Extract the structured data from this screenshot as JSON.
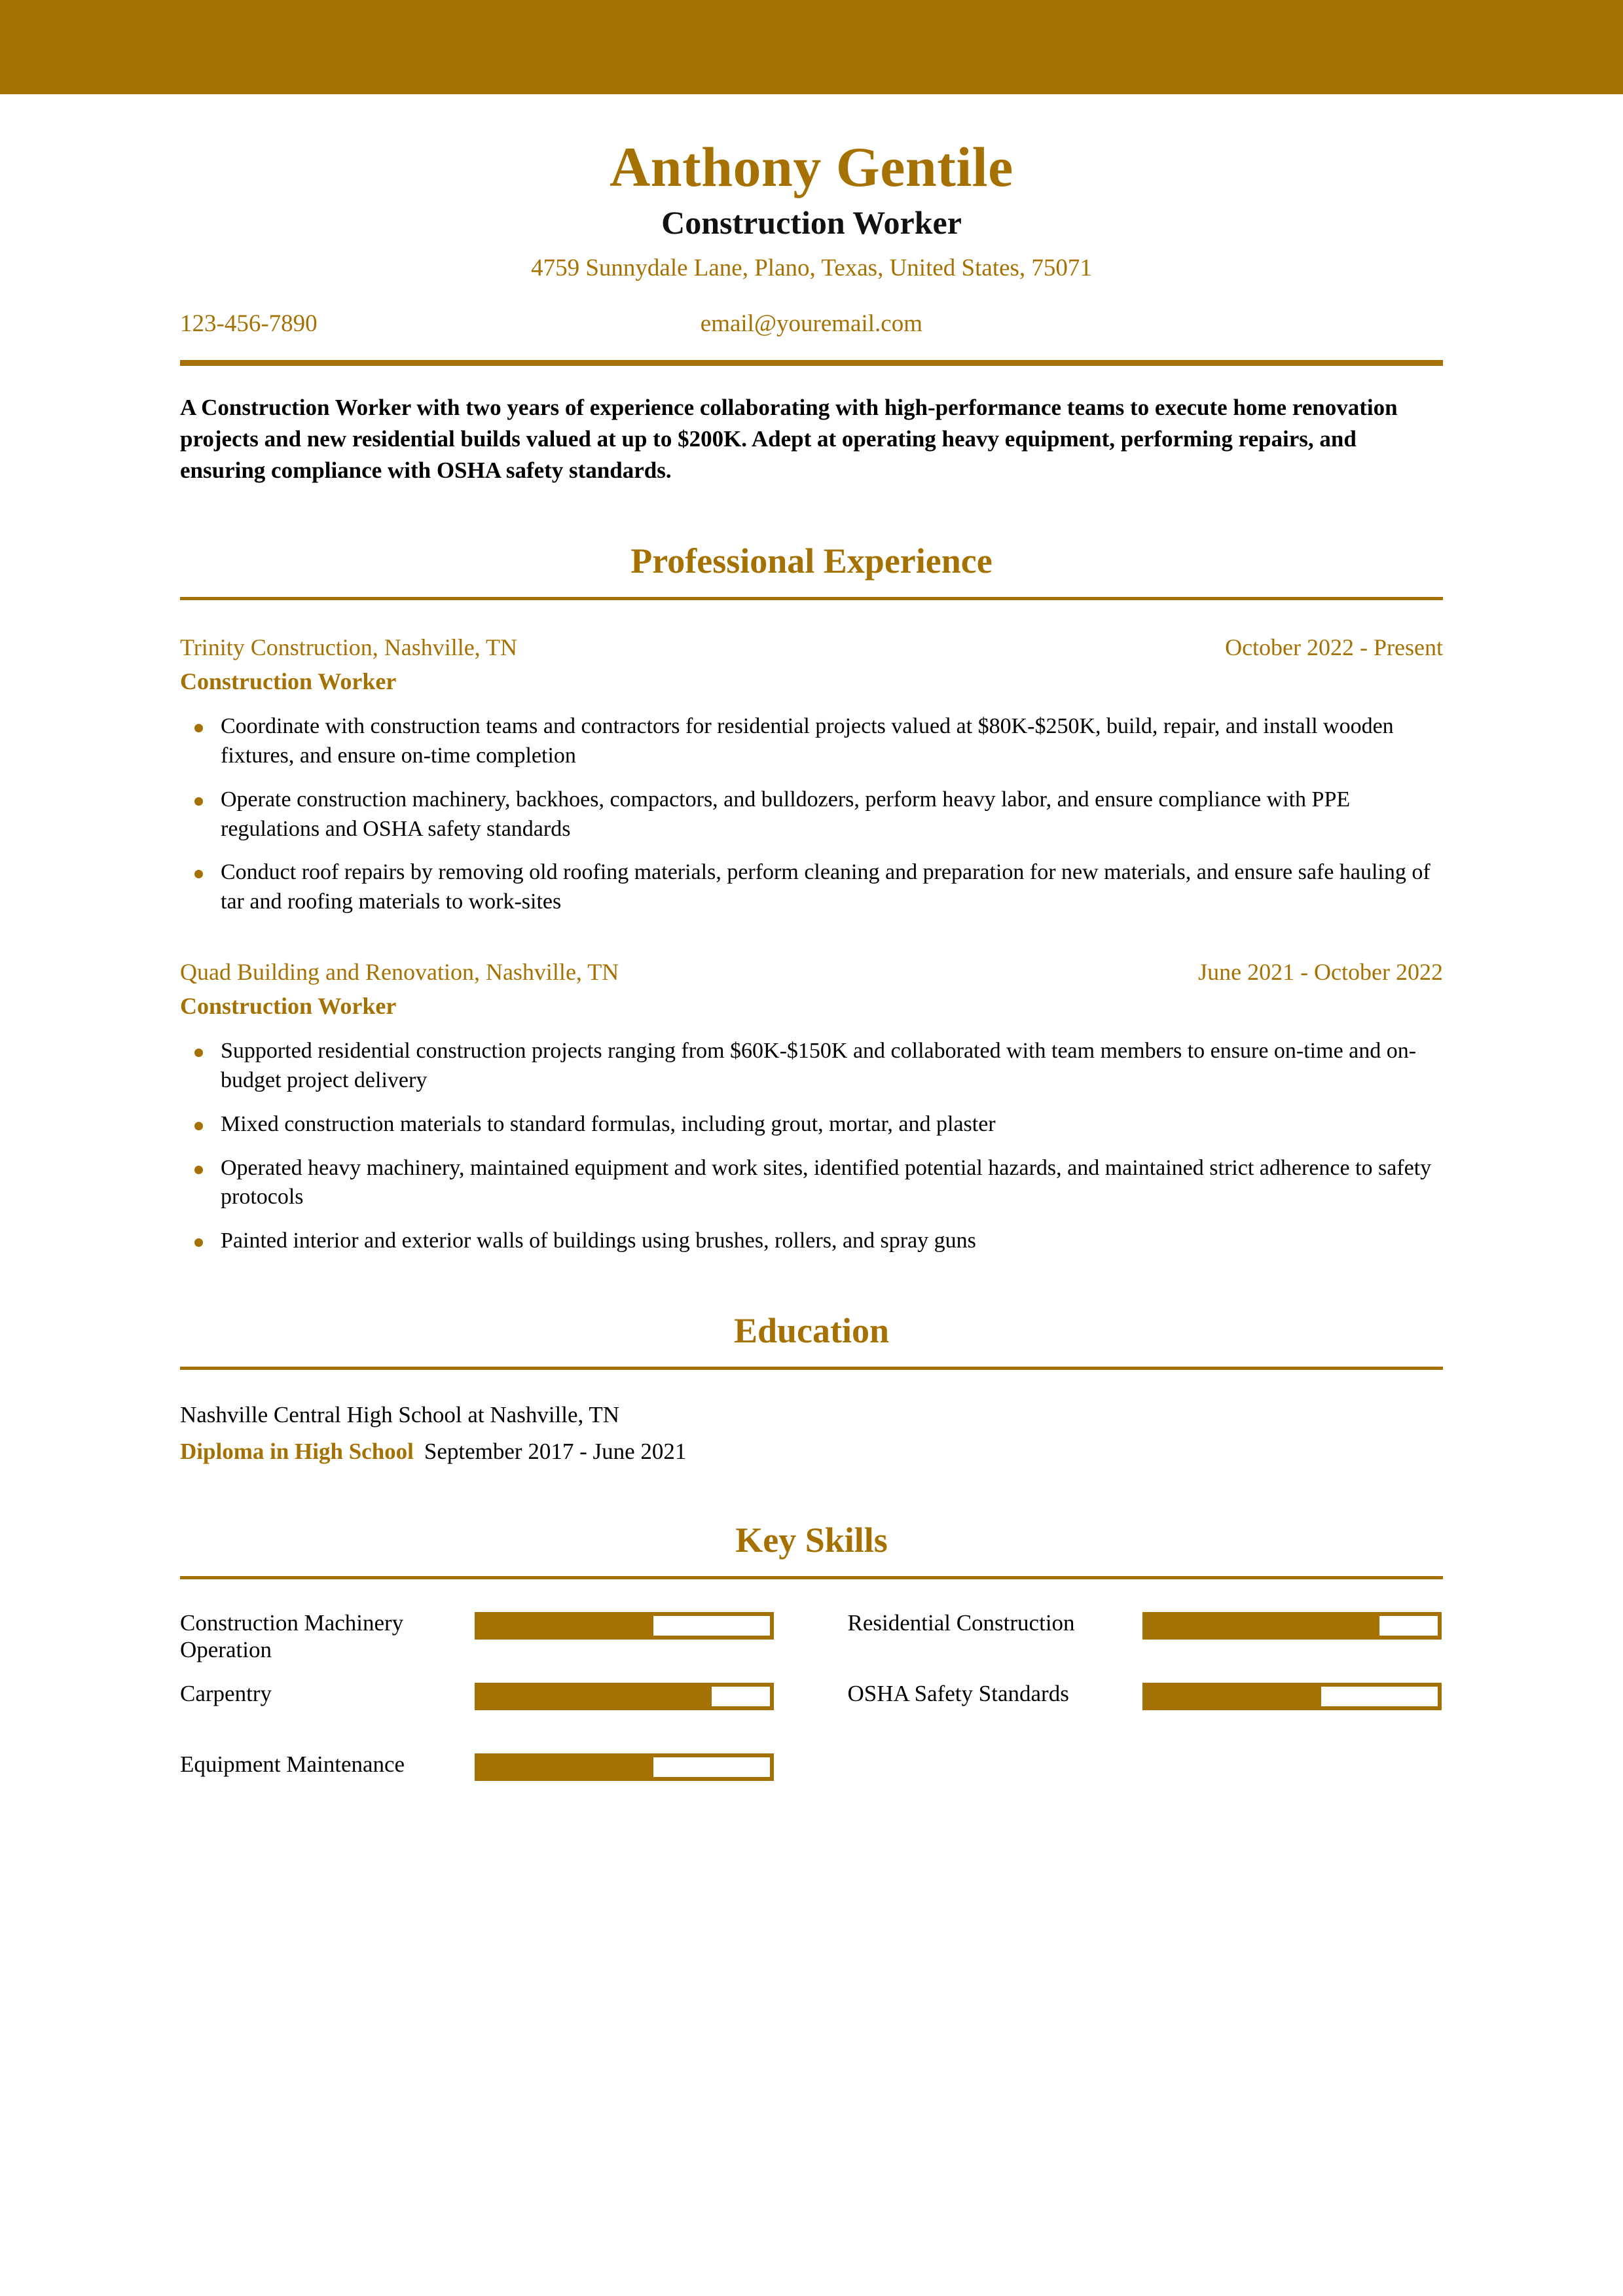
{
  "theme": {
    "accent": "#A67103",
    "text": "#000000"
  },
  "header": {
    "name": "Anthony Gentile",
    "job_title": "Construction Worker",
    "address": "4759 Sunnydale Lane, Plano, Texas, United States, 75071",
    "phone": "123-456-7890",
    "email": "email@youremail.com"
  },
  "summary": {
    "text": "A Construction Worker with two years of experience collaborating with  high-performance teams to execute home renovation projects and new  residential builds valued at up to $200K. Adept at operating heavy  equipment, performing repairs, and ensuring compliance with OSHA safety  standards."
  },
  "sections": {
    "experience_title": "Professional Experience",
    "education_title": "Education",
    "skills_title": "Key Skills"
  },
  "experience": [
    {
      "company": "Trinity Construction, Nashville, TN",
      "dates": "October 2022 - Present",
      "role": "Construction Worker",
      "bullets": [
        "Coordinate with construction teams and contractors for residential  projects valued at $80K-$250K, build, repair, and install wooden  fixtures, and ensure on-time completion",
        "Operate construction machinery, backhoes, compactors, and  bulldozers, perform heavy labor, and ensure compliance with PPE  regulations and OSHA safety standards",
        "Conduct roof repairs by removing old roofing materials, perform  cleaning and preparation for new materials, and ensure safe hauling of  tar and roofing materials to work-sites"
      ]
    },
    {
      "company": "Quad Building and Renovation, Nashville, TN",
      "dates": "June 2021 - October 2022",
      "role": "Construction Worker",
      "bullets": [
        "Supported residential construction projects ranging from $60K-$150K  and collaborated with team members to ensure on-time and on-budget  project delivery",
        "Mixed construction materials to standard formulas, including grout, mortar, and plaster",
        "Operated heavy machinery, maintained equipment and work sites,  identified potential hazards, and maintained strict adherence to safety  protocols",
        "Painted interior and exterior walls of buildings using brushes, rollers, and spray guns"
      ]
    }
  ],
  "education": [
    {
      "school": "Nashville Central High School at Nashville, TN",
      "degree": "Diploma in High School",
      "dates": "September 2017 - June 2021"
    }
  ],
  "skills": [
    {
      "label": "Construction Machinery Operation",
      "level": 60
    },
    {
      "label": "Residential Construction",
      "level": 80
    },
    {
      "label": "Carpentry",
      "level": 80
    },
    {
      "label": "OSHA Safety Standards",
      "level": 60
    },
    {
      "label": "Equipment Maintenance",
      "level": 60
    }
  ]
}
